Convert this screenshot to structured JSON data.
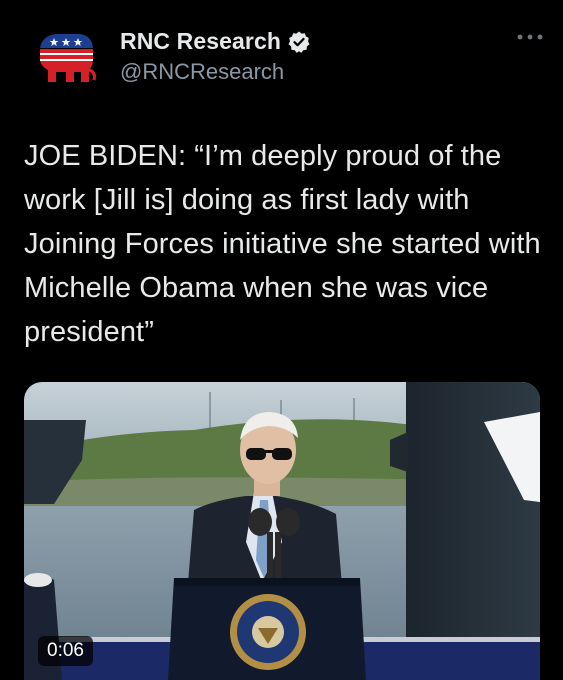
{
  "tweet": {
    "author": {
      "display_name": "RNC Research",
      "handle": "@RNCResearch",
      "verified": true,
      "avatar_icon": "republican-elephant-logo",
      "brand_colors": {
        "red": "#d62027",
        "blue": "#1d3f8f",
        "white": "#ffffff"
      }
    },
    "menu_icon": "more-options-icon",
    "text": "JOE BIDEN: “I’m deeply proud of the work [Jill is] doing as first lady with Joining Forces initiative she started with Michelle Obama when she was vice president”",
    "media": {
      "type": "video",
      "duration": "0:06"
    }
  },
  "colors": {
    "background": "#000000",
    "text_primary": "#e7e9ea",
    "text_secondary": "#8b98a5"
  }
}
